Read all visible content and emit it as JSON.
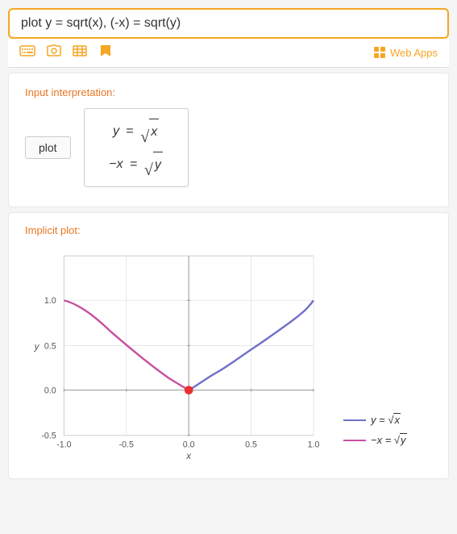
{
  "search": {
    "value": "plot y = sqrt(x), (-x) = sqrt(y)",
    "placeholder": "Search..."
  },
  "toolbar": {
    "icons": [
      "keyboard-icon",
      "camera-icon",
      "grid-icon",
      "bookmark-icon"
    ],
    "web_apps_label": "Web Apps"
  },
  "interpretation": {
    "section_label": "Input interpretation:",
    "plot_button": "plot",
    "equations": [
      "y = √x",
      "-x = √y"
    ]
  },
  "implicit_plot": {
    "section_label": "Implicit plot:",
    "x_axis_label": "x",
    "y_axis_label": "y",
    "x_ticks": [
      "-1.0",
      "-0.5",
      "0.0",
      "0.5",
      "1.0"
    ],
    "y_ticks": [
      "-0.5",
      "0.0",
      "0.5",
      "1.0"
    ],
    "legend": [
      {
        "label": "y = √x",
        "color": "#7070c8"
      },
      {
        "label": "-x = √y",
        "color": "#c850a0"
      }
    ]
  },
  "colors": {
    "orange": "#f5a623",
    "link_orange": "#e87722",
    "curve1": "#7070c8",
    "curve2": "#c850a0",
    "dot": "#e83030"
  }
}
